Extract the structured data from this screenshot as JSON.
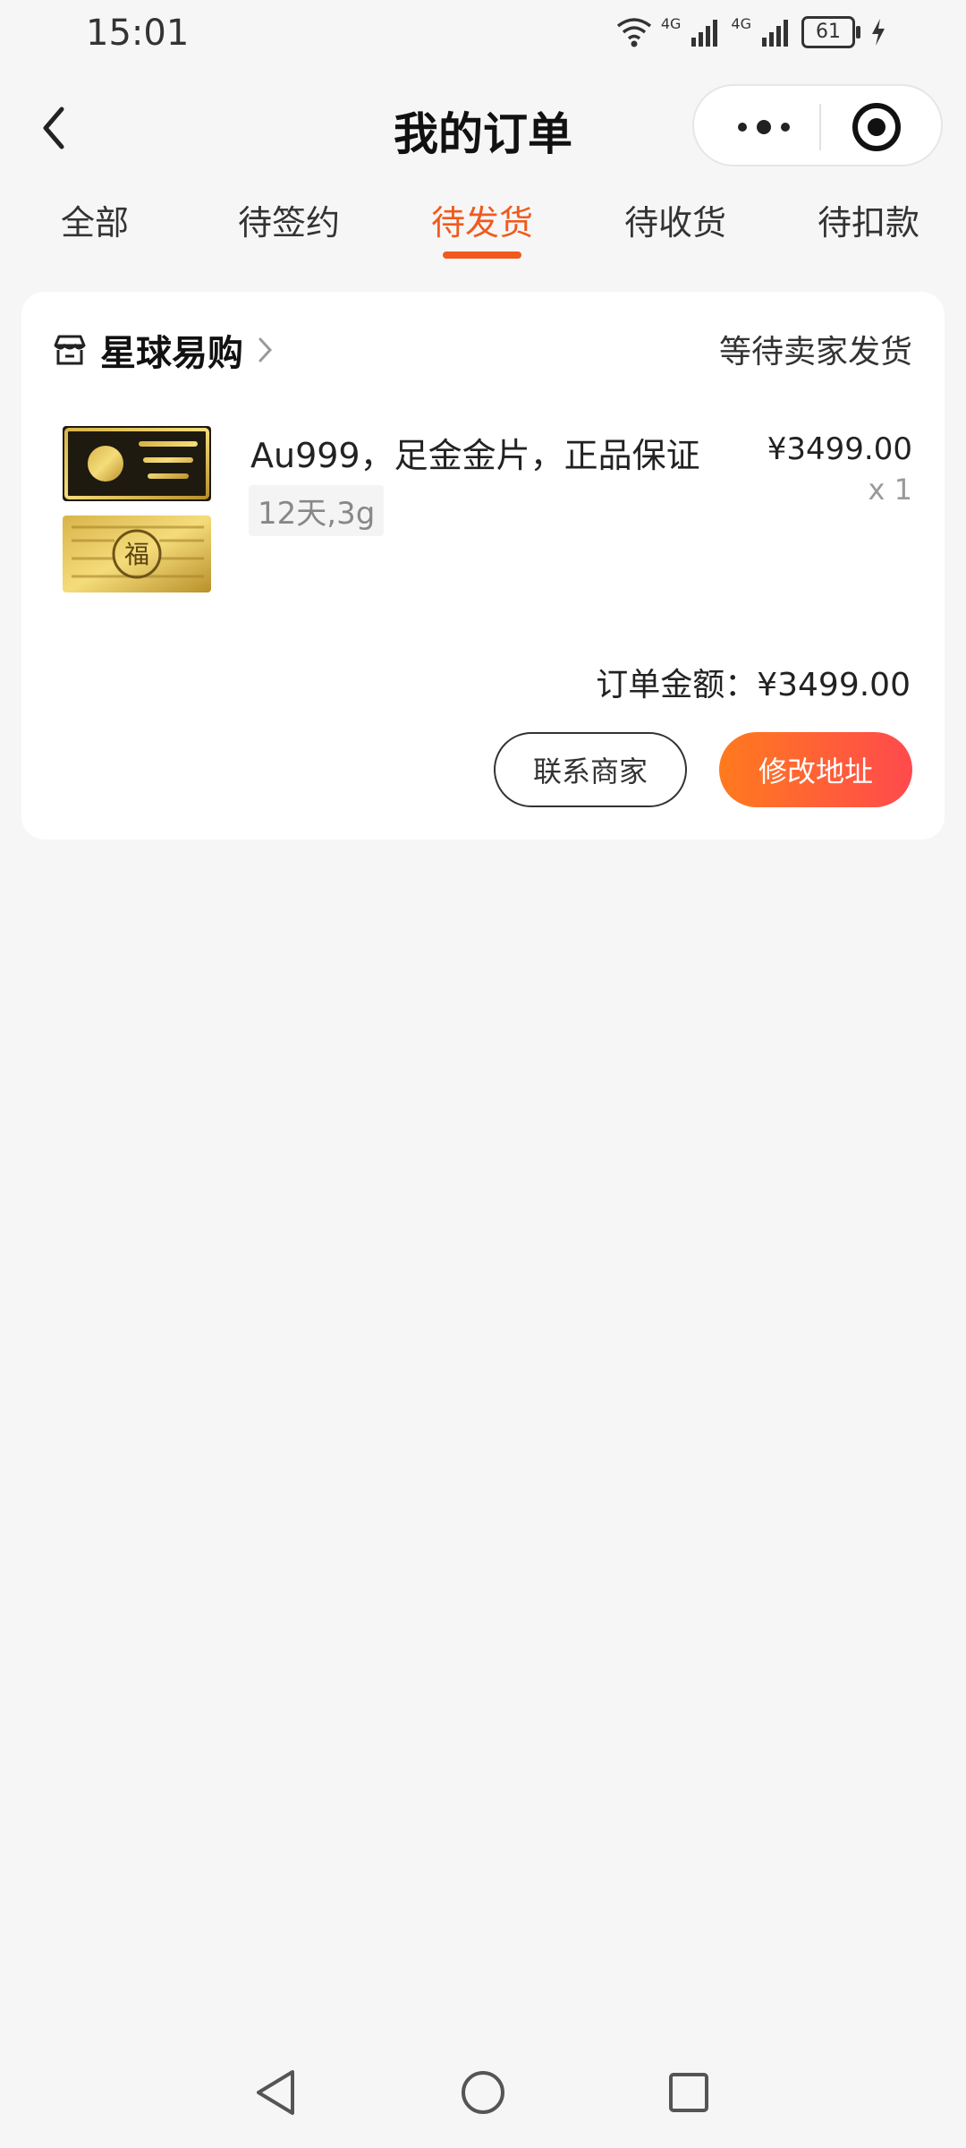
{
  "status_bar": {
    "time": "15:01",
    "network_1": "4G",
    "network_2": "4G",
    "battery": "61"
  },
  "header": {
    "title": "我的订单",
    "icons": [
      "back-icon",
      "more-icon",
      "target-icon"
    ]
  },
  "tabs": [
    {
      "label": "全部"
    },
    {
      "label": "待签约"
    },
    {
      "label": "待发货",
      "active": true
    },
    {
      "label": "待收货"
    },
    {
      "label": "待扣款"
    }
  ],
  "order": {
    "shop_name": "星球易购",
    "status": "等待卖家发货",
    "product_title": "Au999，足金金片，正品保证",
    "spec": "12天,3g",
    "price": "¥3499.00",
    "quantity": "x 1",
    "total": "订单金额：¥3499.00",
    "contact_button": "联系商家",
    "address_button": "修改地址",
    "thumb_caption": "福"
  },
  "colors": {
    "accent": "#f05a1e",
    "button_gradient_start": "#ff7a1e",
    "button_gradient_end": "#ff4a4d",
    "background": "#f6f6f6"
  }
}
